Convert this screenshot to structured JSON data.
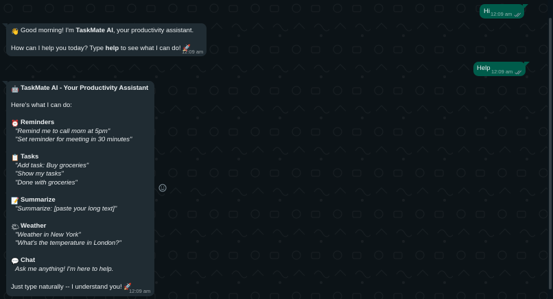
{
  "colors": {
    "background": "#0c1317",
    "incoming_bubble": "#202c33",
    "outgoing_bubble": "#005c4b",
    "text": "#e9edef",
    "tick_read": "#8696a0"
  },
  "messages": {
    "hi": {
      "text": "Hi",
      "time": "12:09 am"
    },
    "greet": {
      "emoji": "waving-hand",
      "line1_pre": "Good morning! I'm ",
      "line1_bold": "TaskMate AI",
      "line1_post": ", your productivity assistant.",
      "line2_pre": "How can I help you today? Type ",
      "line2_bold": "help",
      "line2_post": " to see what I can do! 🚀",
      "time": "12:09 am"
    },
    "help": {
      "text": "Help",
      "time": "12:09 am"
    },
    "help_reply": {
      "title": "TaskMate AI - Your Productivity Assistant",
      "intro": "Here's what I can do:",
      "sections": [
        {
          "icon": "alarm-clock",
          "heading": "Reminders",
          "examples": [
            "\"Remind me to call mom at 5pm\"",
            "\"Set reminder for meeting in 30 minutes\""
          ]
        },
        {
          "icon": "clipboard",
          "heading": "Tasks",
          "examples": [
            "\"Add task: Buy groceries\"",
            "\"Show my tasks\"",
            "\"Done with groceries\""
          ]
        },
        {
          "icon": "memo",
          "heading": "Summarize",
          "examples": [
            "\"Summarize: [paste your long text]\""
          ]
        },
        {
          "icon": "sun-behind-cloud",
          "heading": "Weather",
          "examples": [
            "\"Weather in New York\"",
            "\"What's the temperature in London?\""
          ]
        },
        {
          "icon": "speech-bubble",
          "heading": "Chat",
          "examples": [
            "Ask me anything! I'm here to help."
          ]
        }
      ],
      "footer": "Just type naturally -- I understand you! 🚀",
      "time": "12:09 am"
    }
  }
}
